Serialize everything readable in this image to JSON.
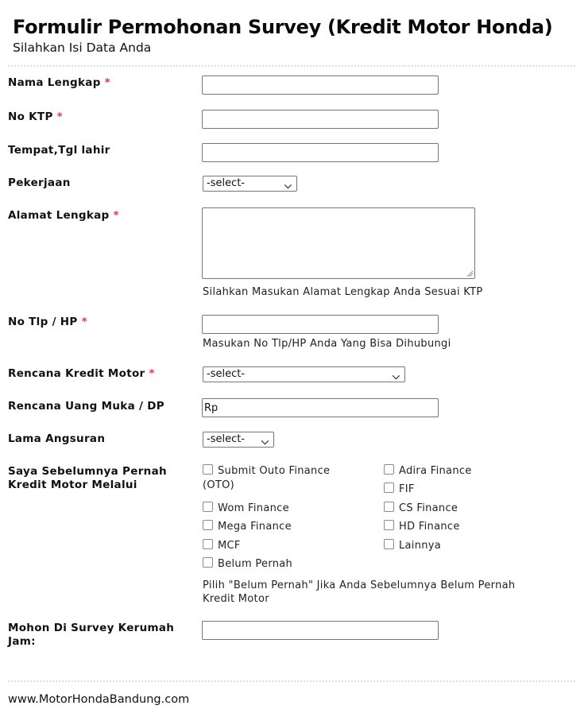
{
  "header": {
    "title": "Formulir Permohonan Survey (Kredit Motor Honda)",
    "subtitle": "Silahkan Isi Data Anda"
  },
  "required_marker": "*",
  "fields": {
    "nama": {
      "label": "Nama Lengkap",
      "required": true,
      "value": ""
    },
    "ktp": {
      "label": "No KTP",
      "required": true,
      "value": ""
    },
    "ttl": {
      "label": "Tempat,Tgl lahir",
      "required": false,
      "value": ""
    },
    "pekerjaan": {
      "label": "Pekerjaan",
      "required": false,
      "selected": "-select-"
    },
    "alamat": {
      "label": "Alamat Lengkap",
      "required": true,
      "value": "",
      "hint": "Silahkan Masukan Alamat Lengkap Anda Sesuai KTP"
    },
    "tlp": {
      "label": "No Tlp / HP",
      "required": true,
      "value": "",
      "hint": "Masukan No Tlp/HP Anda Yang Bisa Dihubungi"
    },
    "kredit_motor": {
      "label": "Rencana Kredit Motor",
      "required": true,
      "selected": "-select-"
    },
    "uang_muka": {
      "label": "Rencana Uang Muka / DP",
      "required": false,
      "value": "Rp"
    },
    "angsuran": {
      "label": "Lama Angsuran",
      "required": false,
      "selected": "-select-"
    },
    "pernah_kredit": {
      "label_line1": "Saya Sebelumnya Pernah",
      "label_line2": "Kredit Motor Melalui",
      "options": [
        {
          "label": "Submit Outo Finance",
          "label_cont": "(OTO)",
          "checked": false
        },
        {
          "label": "Adira Finance",
          "checked": false
        },
        {
          "label": "FIF",
          "checked": false
        },
        {
          "label": "Wom Finance",
          "checked": false
        },
        {
          "label": "CS Finance",
          "checked": false
        },
        {
          "label": "Mega Finance",
          "checked": false
        },
        {
          "label": "HD Finance",
          "checked": false
        },
        {
          "label": "MCF",
          "checked": false
        },
        {
          "label": "Lainnya",
          "checked": false
        },
        {
          "label": "Belum Pernah",
          "checked": false
        }
      ],
      "hint_line1": "Pilih \"Belum Pernah\" Jika Anda Sebelumnya Belum Pernah",
      "hint_line2": "Kredit Motor"
    },
    "survey_jam": {
      "label_line1": "Mohon Di Survey Kerumah",
      "label_line2": "Jam:",
      "value": ""
    }
  },
  "icons": {
    "select_arrow": "chevron-down-icon",
    "resize": "resize-grip-icon"
  },
  "footer": {
    "text": "www.MotorHondaBandung.com"
  },
  "colors": {
    "required": "#e8344c",
    "border": "#767676"
  }
}
